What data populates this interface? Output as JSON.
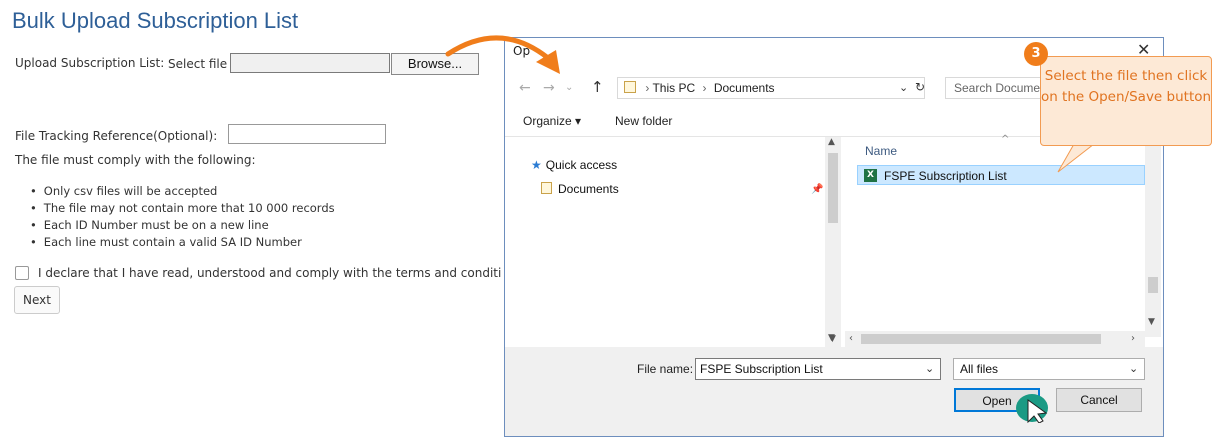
{
  "page": {
    "title": "Bulk Upload Subscription List",
    "upload_label": "Upload Subscription List:",
    "select_file_label": "Select file",
    "browse_label": "Browse...",
    "tracking_label": "File Tracking Reference(Optional):",
    "tracking_value": "",
    "comply_text": "The file must comply with the following:",
    "rules": [
      "Only csv files will be accepted",
      "The file may not contain more that 10 000 records",
      "Each ID Number must be on a new line",
      "Each line must contain a valid SA ID Number"
    ],
    "declare_text": "I declare that I have read, understood and comply with the terms and conditi",
    "next_label": "Next"
  },
  "dialog": {
    "title_fragment": "Op",
    "path": [
      "This PC",
      "Documents"
    ],
    "search_placeholder": "Search Documents",
    "organize_label": "Organize",
    "new_folder_label": "New folder",
    "nav": {
      "quick_access": "Quick access",
      "documents": "Documents"
    },
    "column_name": "Name",
    "files": [
      {
        "name": "FSPE Subscription List",
        "icon": "excel-file-icon",
        "selected": true
      }
    ],
    "file_name_label": "File name:",
    "file_name_value": "FSPE Subscription List",
    "filter_value": "All files",
    "open_label": "Open",
    "cancel_label": "Cancel"
  },
  "callout": {
    "step": "3",
    "text": "Select the file then click on the Open/Save button"
  },
  "colors": {
    "title_blue": "#2e5f97",
    "callout_orange": "#f07d1b",
    "cursor_teal": "#1a9a84",
    "selection_blue": "#cce8ff"
  }
}
